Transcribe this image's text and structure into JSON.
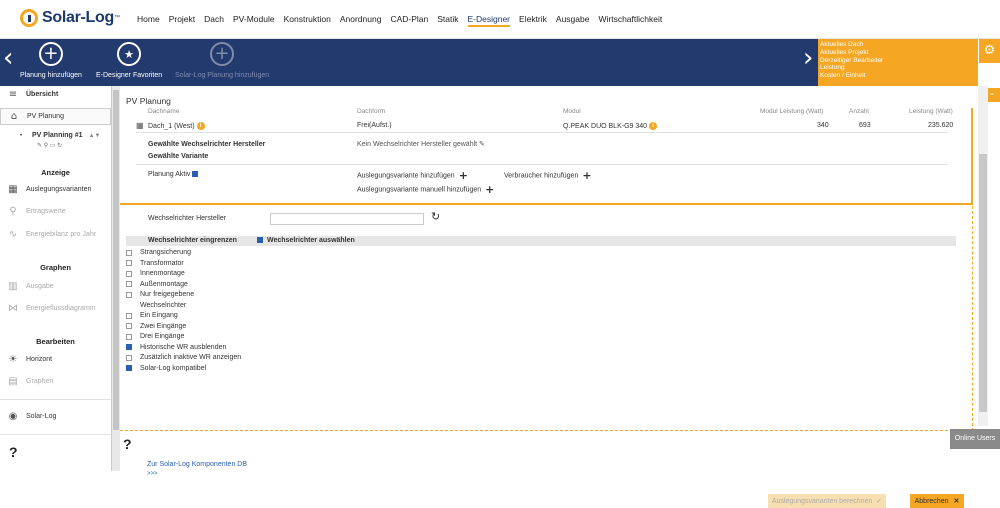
{
  "brand": {
    "name": "Solar-Log",
    "tm": "™"
  },
  "menu": [
    "Home",
    "Projekt",
    "Dach",
    "PV-Module",
    "Konstruktion",
    "Anordnung",
    "CAD-Plan",
    "Statik",
    "E-Designer",
    "Elektrik",
    "Ausgabe",
    "Wirtschaftlichkeit"
  ],
  "menu_active": "E-Designer",
  "toolbar": {
    "add_label": "Planung hinzufügen",
    "favorites_label": "E-Designer Favoriten",
    "solarlog_label": "Solar-Log Planung hinzufügen"
  },
  "infobox": [
    "Aktuelles Dach",
    "Aktuelles Projekt",
    "Derzeitiger Bearbeiter",
    "Leistung",
    "Kosten / Einheit"
  ],
  "sidebar": {
    "overview": "Übersicht",
    "pv_planung": "PV Planung",
    "pv_planning_1": "PV Planning #1",
    "anzeige": "Anzeige",
    "auslegungsvarianten": "Auslegungsvarianten",
    "ertragswerte": "Ertragswerte",
    "energiebilanz": "Energiebilanz pro Jahr",
    "graphen": "Graphen",
    "ausgabe": "Ausgabe",
    "energiefluss": "Energieflussdiagramm",
    "bearbeiten": "Bearbeiten",
    "horizont": "Horizont",
    "graphen2": "Graphen",
    "solarlog": "Solar-Log",
    "help": "?"
  },
  "content": {
    "title": "PV Planung",
    "headers": {
      "dachname": "Dachname",
      "dachform": "Dachform",
      "modul": "Modul",
      "modulleistung": "Modul Leistung (Watt)",
      "anzahl": "Anzahl",
      "leistung": "Leistung (Watt)"
    },
    "row": {
      "dachname": "Dach_1 (West)",
      "dachform": "Frei(Aufst.)",
      "modul": "Q.PEAK DUO BLK-G9 340",
      "modulleistung": "340",
      "anzahl": "693",
      "leistung": "235.620"
    },
    "wr_hersteller_label": "Gewählte Wechselrichter Hersteller",
    "wr_hersteller_value": "Kein Wechselrichter Hersteller gewählt",
    "variante_label": "Gewählte Variante",
    "planung_aktiv": "Planung Aktiv",
    "add_variant": "Auslegungsvariante hinzufügen",
    "add_consumer": "Verbraucher hinzufügen",
    "add_variant_manual": "Auslegungsvariante manuell hinzufügen",
    "wr_hersteller_field": "Wechselrichter Hersteller",
    "wr_eingrenzen": "Wechselrichter eingrenzen",
    "wr_auswaehlen": "Wechselrichter auswählen",
    "filters": [
      {
        "label": "Strangsicherung",
        "checked": false
      },
      {
        "label": "Transformator",
        "checked": false
      },
      {
        "label": "Innenmontage",
        "checked": false
      },
      {
        "label": "Außenmontage",
        "checked": false
      },
      {
        "label": "Nur freigegebene",
        "checked": false
      },
      {
        "label": "Wechselrichter",
        "checked": false
      },
      {
        "label": "Ein Eingang",
        "checked": false
      },
      {
        "label": "Zwei Eingänge",
        "checked": false
      },
      {
        "label": "Drei Eingänge",
        "checked": false
      },
      {
        "label": "Historische WR ausblenden",
        "checked": true
      },
      {
        "label": "Zusätzlich inaktive WR anzeigen",
        "checked": false
      },
      {
        "label": "Solar-Log kompatibel",
        "checked": true
      }
    ],
    "db_link": "Zur Solar-Log Komponenten DB",
    "more": ">>>",
    "calc_button": "Auslegungsvarianten berechnen",
    "cancel_button": "Abbrechen",
    "help": "?"
  },
  "online_users": "Online Users",
  "colors": {
    "navy": "#233a6f",
    "orange": "#f5a623",
    "blue_check": "#2a5fb0"
  }
}
